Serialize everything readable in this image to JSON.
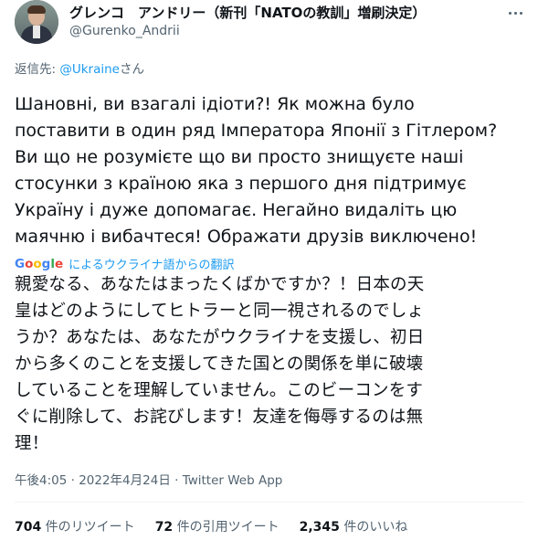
{
  "author": {
    "name": "グレンコ　アンドリー（新刊「NATOの教訓」増刷決定）",
    "handle": "@Gurenko_Andrii"
  },
  "reply": {
    "prefix": "返信先: ",
    "to": "@Ukraine",
    "suffix": "さん"
  },
  "tweet": {
    "text": "Шановні, ви взагалі ідіоти?! Як можна було\nпоставити в один ряд Імператора Японії з Гітлером?\nВи що не розумієте що ви просто знищуєте наші\nстосунки з країною яка з першого дня підтримує\nУкраїну і дуже допомагає. Негайно видаліть цю\nмаячню і вибачтеся! Ображати друзів виключено!"
  },
  "translation": {
    "logo": "Google",
    "label": "によるウクライナ語からの翻訳",
    "text": "親愛なる、あなたはまったくばかですか？！日本の天\n皇はどのようにしてヒトラーと同一視されるのでしょ\nうか？あなたは、あなたがウクライナを支援し、初日\nから多くのことを支援してきた国との関係を単に破壊\nしていることを理解していません。このビーコンをす\nぐに削除して、お詫びします！友達を侮辱するのは無\n理！"
  },
  "meta": {
    "time": "午後4:05",
    "sep1": " · ",
    "date": "2022年4月24日",
    "sep2": " · ",
    "source": "Twitter Web App"
  },
  "stats": {
    "retweets_count": "704",
    "retweets_label": " 件のリツイート",
    "quotes_count": "72",
    "quotes_label": " 件の引用ツイート",
    "likes_count": "2,345",
    "likes_label": " 件のいいね"
  },
  "colors": {
    "accent": "#1d9bf0",
    "secondary_text": "#536471",
    "google_blue": "#4285f4",
    "google_red": "#ea4335",
    "google_yellow": "#fbbc05",
    "google_green": "#34a853"
  }
}
